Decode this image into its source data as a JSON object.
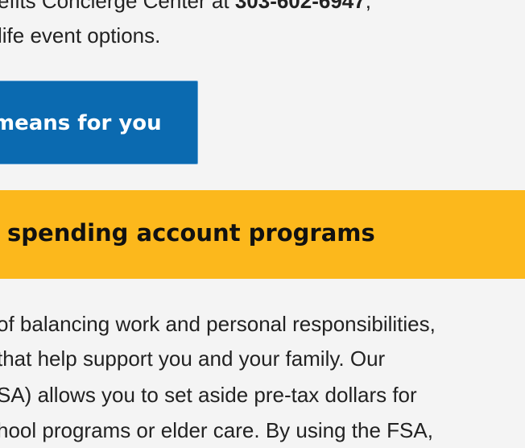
{
  "intro": {
    "line1_text": "efits Concierge Center at ",
    "line1_phone": "303-602-6947",
    "line1_suffix": ",",
    "line2": "life event options."
  },
  "cta": {
    "label": "means for you"
  },
  "banner": {
    "heading": " spending account programs",
    "color": "#fcb81c"
  },
  "body": {
    "lines": [
      "of balancing work and personal responsibilities,",
      "that help support you and your family. Our",
      "SA) allows you to set aside pre-tax dollars for",
      "hool programs or elder care. By using the FSA,"
    ]
  },
  "colors": {
    "page_background": "#f4f4f4",
    "button_blue": "#0b6ab0",
    "text": "#222222"
  }
}
